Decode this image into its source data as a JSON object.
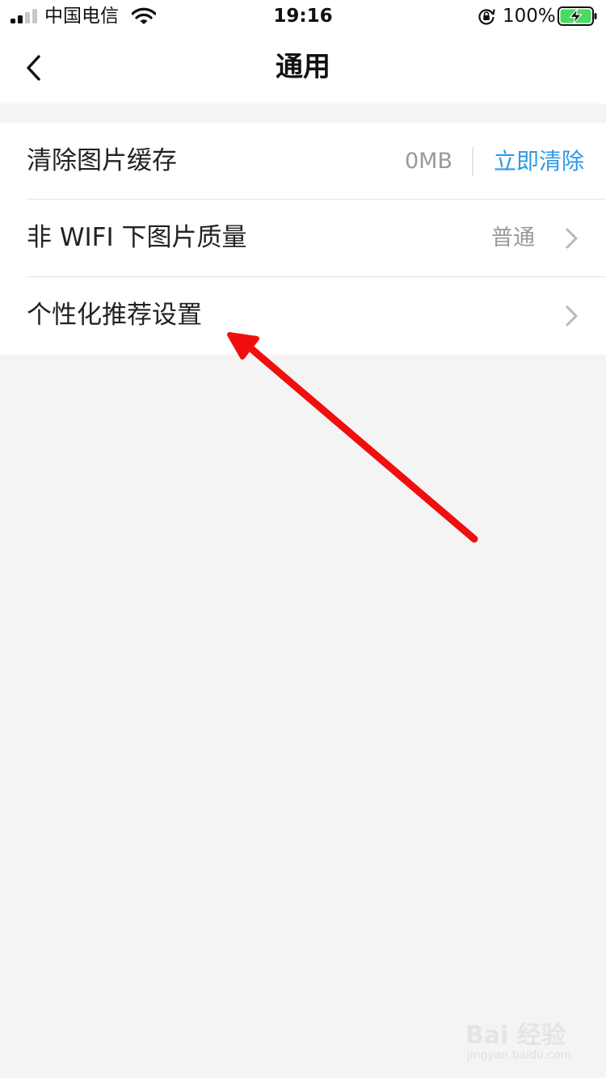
{
  "status_bar": {
    "carrier": "中国电信",
    "time": "19:16",
    "battery_percent": "100%",
    "signal_bars_lit": 2,
    "signal_bars_total": 4,
    "battery_level": 1.0,
    "charging": true
  },
  "nav": {
    "title": "通用",
    "back_icon": "chevron-left-icon"
  },
  "settings": {
    "clear_cache": {
      "label": "清除图片缓存",
      "value": "0MB",
      "action": "立即清除"
    },
    "image_quality": {
      "label": "非 WIFI 下图片质量",
      "value": "普通",
      "icon": "chevron-right-icon"
    },
    "personalized": {
      "label": "个性化推荐设置",
      "icon": "chevron-right-icon"
    }
  },
  "watermark": {
    "main": "Bai 经验",
    "sub": "jingyan.baidu.com"
  },
  "colors": {
    "accent_blue": "#2d9ae6",
    "annotation_red": "#f10e0e",
    "battery_green": "#4cd964",
    "page_background": "#f4f4f4"
  }
}
